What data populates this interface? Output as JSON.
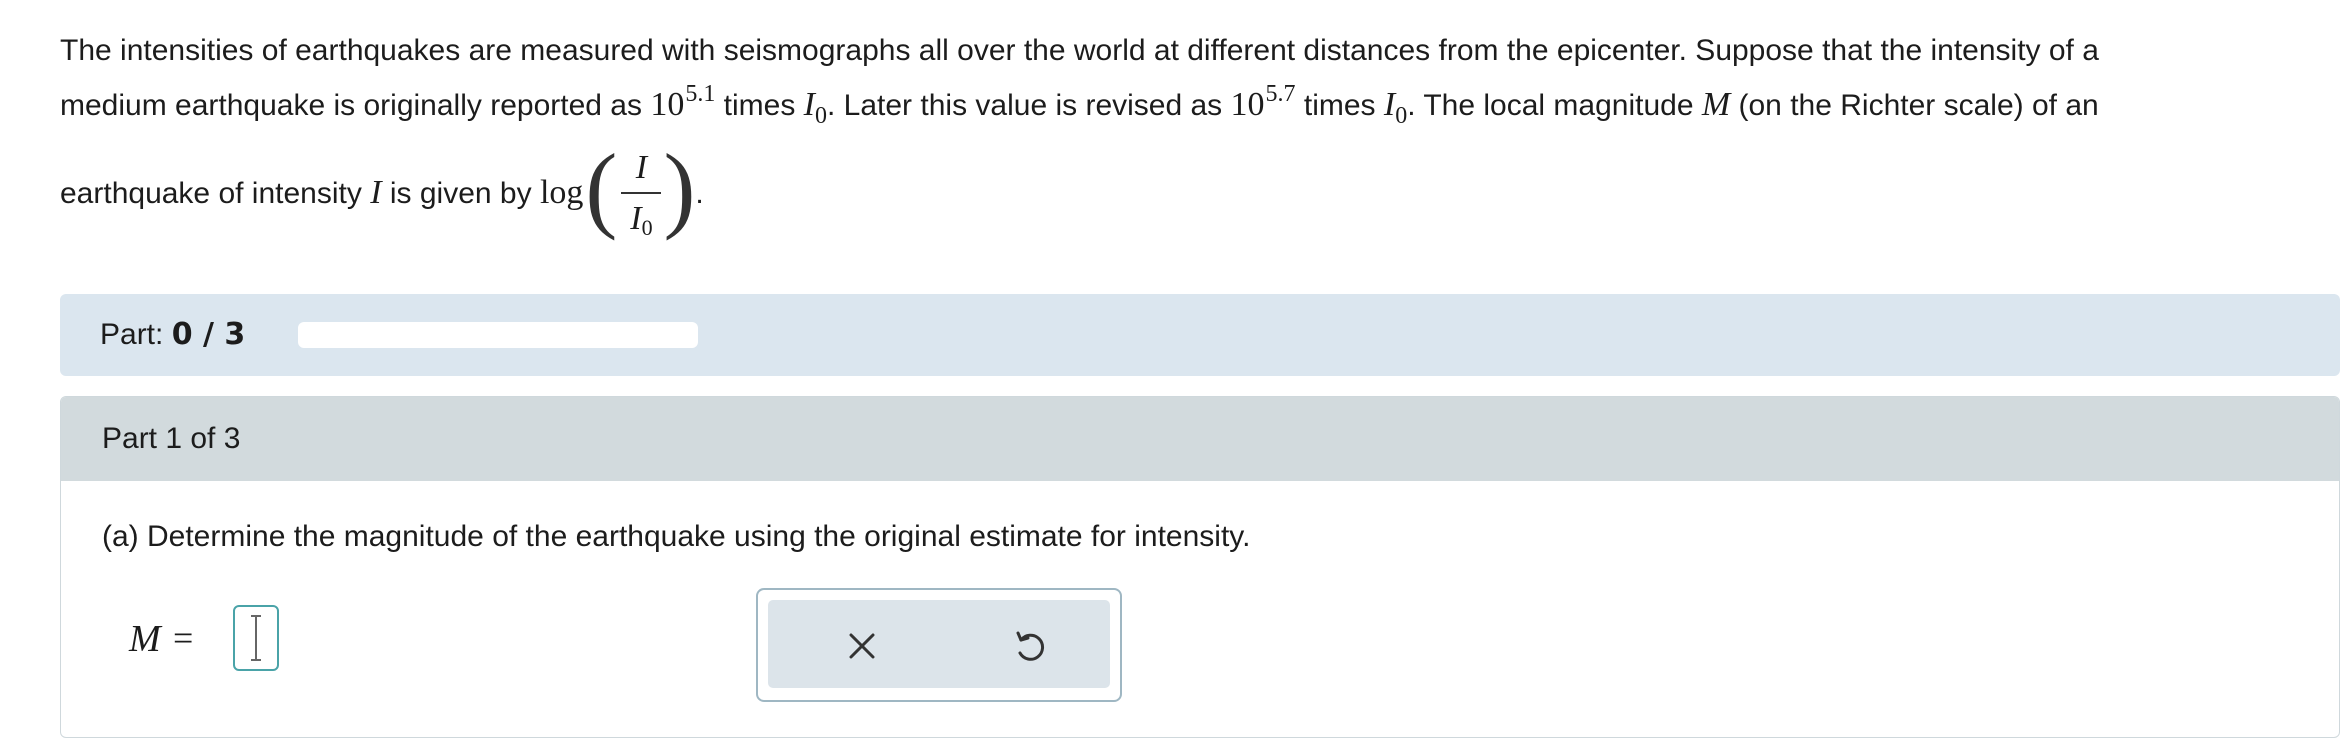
{
  "problem": {
    "line1": "The intensities of earthquakes are measured with seismographs all over the world at different distances from the epicenter. Suppose that the intensity of a",
    "line2_a": "medium earthquake is originally reported as ",
    "base1": "10",
    "exp1": "5.1",
    "line2_b": " times ",
    "I0_letter": "I",
    "I0_sub": "0",
    "line2_c": ". Later this value is revised as ",
    "base2": "10",
    "exp2": "5.7",
    "line2_d": " times ",
    "line2_e": ". The local magnitude ",
    "M_var": "M",
    "line2_f": " (on the Richter scale) of an",
    "line3_a": "earthquake of intensity ",
    "I_var": "I",
    "line3_b": " is given by ",
    "log": "log",
    "frac_num": "I",
    "frac_den_letter": "I",
    "frac_den_sub": "0",
    "line3_end": "."
  },
  "part_bar": {
    "label": "Part: ",
    "progress_text": "0 / 3",
    "progress_fraction": 0,
    "accent": "#4e8ab8"
  },
  "part_panel": {
    "header": "Part 1 of 3",
    "question": "(a) Determine the magnitude of the earthquake using the original estimate for intensity.",
    "answer_var": "M",
    "answer_eq": "=",
    "answer_value": ""
  },
  "actions": {
    "clear_icon": "close-icon",
    "undo_icon": "undo-icon"
  }
}
